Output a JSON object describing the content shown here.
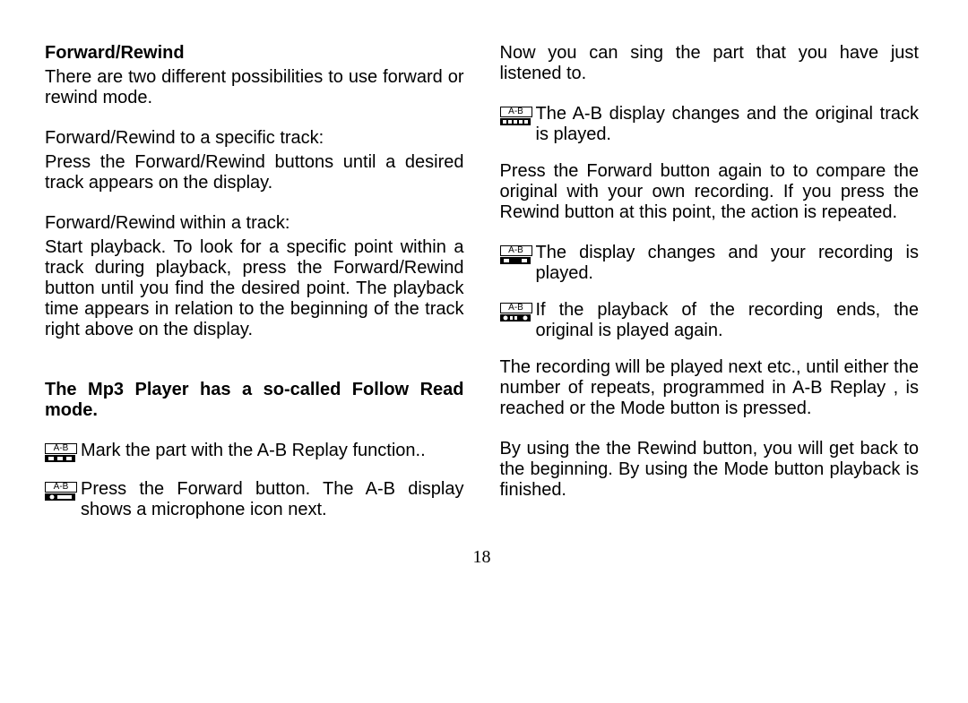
{
  "page_number": "18",
  "left": {
    "h1": "Forward/Rewind",
    "p1": "There are two different possibilities to use forward or rewind mode.",
    "p2": "Forward/Rewind to a specific track:",
    "p3": "Press the Forward/Rewind buttons until a desired  track appears on the display.",
    "p4": "Forward/Rewind within a track:",
    "p5": "Start playback. To look for a specific point within a  track during playback, press the Forward/Rewind button until you  find the desired point. The playback time appears in relation to the beginning of the track right above on the display.",
    "h2": "The Mp3 Player  has a so-called Follow Read mode.",
    "i1": "Mark the part with the A-B Replay function..",
    "i2": "Press the Forward button. The A-B display shows a microphone icon next."
  },
  "right": {
    "p1": "Now you can sing the part that you have just listened to.",
    "i1": "The A-B display changes and the original track is played.",
    "p2": "Press the Forward button again to to compare the original with your own recording. If you press the Rewind button at this point, the action is repeated.",
    "i2": "The display changes and your recording is played.",
    "i3": "If the playback of the recording ends, the original is played again.",
    "p3": "The recording will be played next etc., until either the number of repeats, programmed in A-B Replay , is reached or the Mode button is pressed.",
    "p4": "By using the the Rewind button, you will get back to the beginning. By using the Mode button playback is finished."
  },
  "icon_label": "A-B"
}
